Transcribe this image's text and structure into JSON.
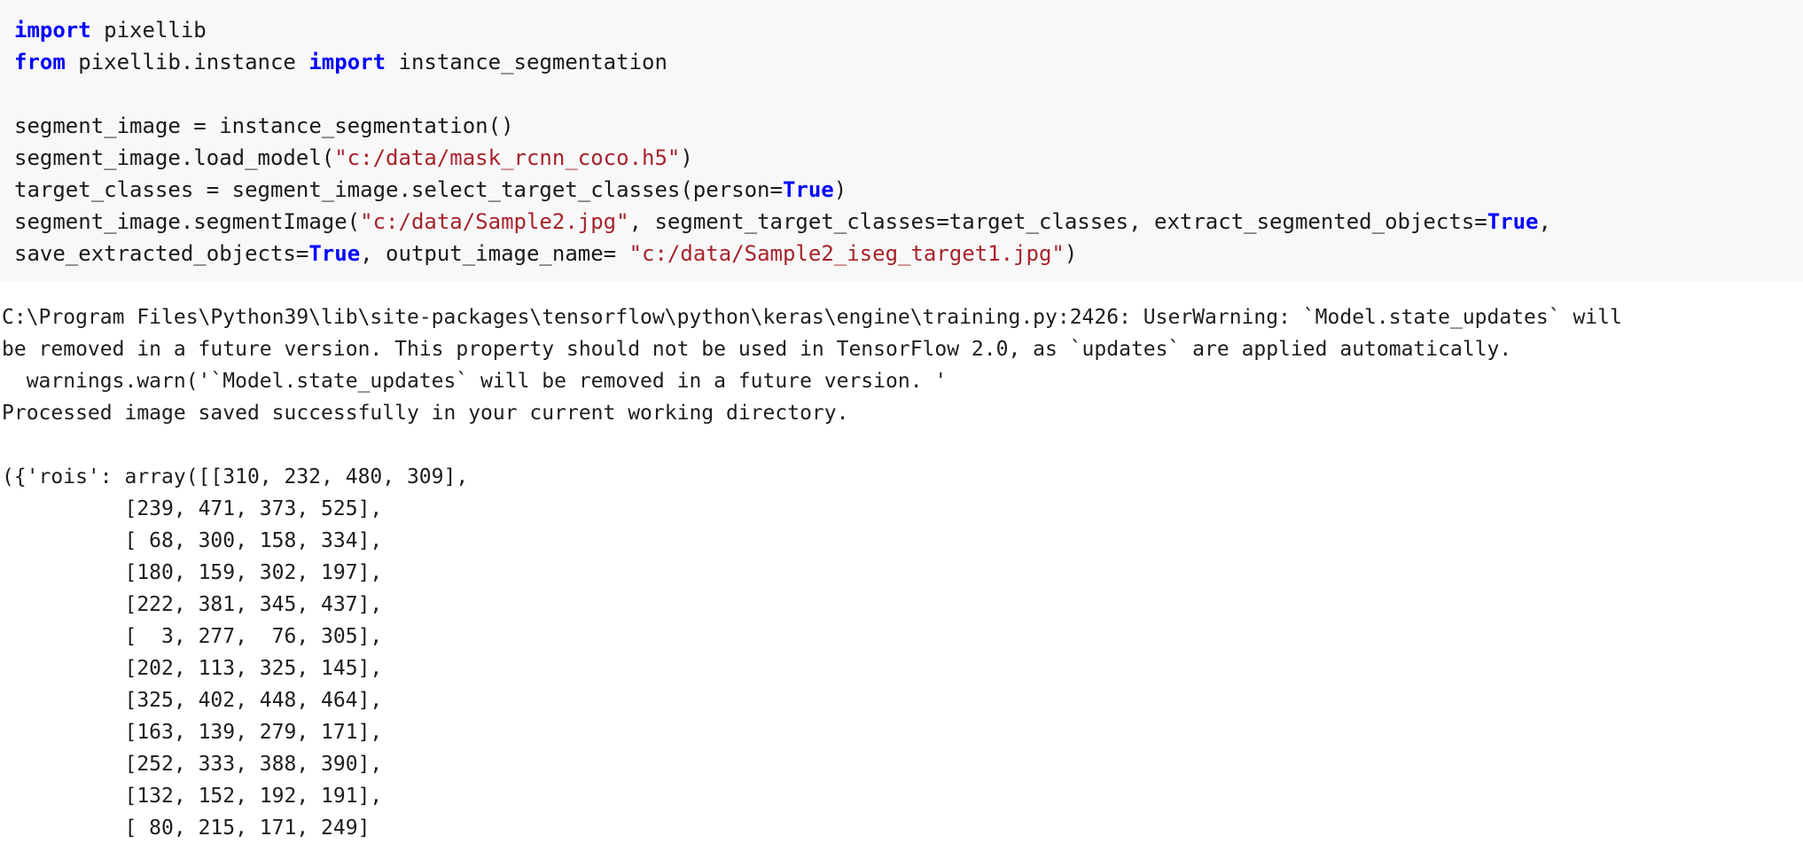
{
  "code_cell": {
    "lines": [
      [
        {
          "t": "import",
          "c": "kw"
        },
        {
          "t": " pixellib",
          "c": ""
        }
      ],
      [
        {
          "t": "from",
          "c": "kw"
        },
        {
          "t": " pixellib.instance ",
          "c": ""
        },
        {
          "t": "import",
          "c": "kw"
        },
        {
          "t": " instance_segmentation",
          "c": ""
        }
      ],
      [],
      [
        {
          "t": "segment_image = instance_segmentation()",
          "c": ""
        }
      ],
      [
        {
          "t": "segment_image.load_model(",
          "c": ""
        },
        {
          "t": "\"c:/data/mask_rcnn_coco.h5\"",
          "c": "str"
        },
        {
          "t": ")",
          "c": ""
        }
      ],
      [
        {
          "t": "target_classes = segment_image.select_target_classes(person=",
          "c": ""
        },
        {
          "t": "True",
          "c": "kw"
        },
        {
          "t": ")",
          "c": ""
        }
      ],
      [
        {
          "t": "segment_image.segmentImage(",
          "c": ""
        },
        {
          "t": "\"c:/data/Sample2.jpg\"",
          "c": "str"
        },
        {
          "t": ", segment_target_classes=target_classes, extract_segmented_objects=",
          "c": ""
        },
        {
          "t": "True",
          "c": "kw"
        },
        {
          "t": ",",
          "c": ""
        }
      ],
      [
        {
          "t": "save_extracted_objects=",
          "c": ""
        },
        {
          "t": "True",
          "c": "kw"
        },
        {
          "t": ", output_image_name= ",
          "c": ""
        },
        {
          "t": "\"c:/data/Sample2_iseg_target1.jpg\"",
          "c": "str"
        },
        {
          "t": ")",
          "c": ""
        }
      ]
    ]
  },
  "output": {
    "warning_lines": [
      "C:\\Program Files\\Python39\\lib\\site-packages\\tensorflow\\python\\keras\\engine\\training.py:2426: UserWarning: `Model.state_updates` will",
      "be removed in a future version. This property should not be used in TensorFlow 2.0, as `updates` are applied automatically.",
      "  warnings.warn('`Model.state_updates` will be removed in a future version. '"
    ],
    "status_line": "Processed image saved successfully in your current working directory.",
    "rois_prefix": "({'rois': array([",
    "rois_rows": [
      "[310, 232, 480, 309],",
      "[239, 471, 373, 525],",
      "[ 68, 300, 158, 334],",
      "[180, 159, 302, 197],",
      "[222, 381, 345, 437],",
      "[  3, 277,  76, 305],",
      "[202, 113, 325, 145],",
      "[325, 402, 448, 464],",
      "[163, 139, 279, 171],",
      "[252, 333, 388, 390],",
      "[132, 152, 192, 191],",
      "[ 80, 215, 171, 249]"
    ],
    "rois_indent": "       "
  },
  "colors": {
    "keyword": "#0000ff",
    "string": "#a8232b",
    "text": "#1a1a1a",
    "code_background": "#f8f8f8",
    "page_background": "#ffffff"
  }
}
